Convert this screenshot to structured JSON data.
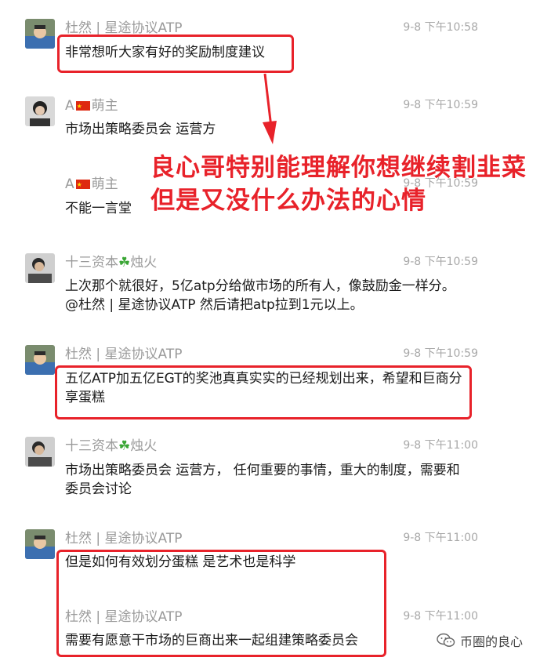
{
  "messages": [
    {
      "sender": "杜然 | 星途协议ATP",
      "time": "9-8 下午10:58",
      "text": "非常想听大家有好的奖励制度建议"
    },
    {
      "sender_pre": "A",
      "sender_post": "萌主",
      "time": "9-8 下午10:59",
      "text": "市场出策略委员会 运营方"
    },
    {
      "sender_pre": "A",
      "sender_post": "萌主",
      "time": "9-8 下午10:59",
      "text": "不能一言堂"
    },
    {
      "sender_pre": "十三资本",
      "sender_post": "烛火",
      "time": "9-8 下午10:59",
      "text": "上次那个就很好，5亿atp分给做市场的所有人，像鼓励金一样分。@杜然 | 星途协议ATP  然后请把atp拉到1元以上。"
    },
    {
      "sender": "杜然 | 星途协议ATP",
      "time": "9-8 下午10:59",
      "text": "五亿ATP加五亿EGT的奖池真真实实的已经规划出来，希望和巨商分享蛋糕"
    },
    {
      "sender_pre": "十三资本",
      "sender_post": "烛火",
      "time": "9-8 下午11:00",
      "text": "市场出策略委员会 运营方， 任何重要的事情，重大的制度，需要和委员会讨论"
    },
    {
      "sender": "杜然 | 星途协议ATP",
      "time": "9-8 下午11:00",
      "text": "但是如何有效划分蛋糕 是艺术也是科学"
    },
    {
      "sender": "杜然 | 星途协议ATP",
      "time": "9-8 下午11:00",
      "text": "需要有愿意干市场的巨商出来一起组建策略委员会"
    }
  ],
  "annotation": "良心哥特别能理解你想继续割韭菜但是又没什么办法的心情",
  "watermark": "币圈的良心",
  "colors": {
    "accent_red": "#e8222a",
    "name_gray": "#9a9a9a"
  }
}
